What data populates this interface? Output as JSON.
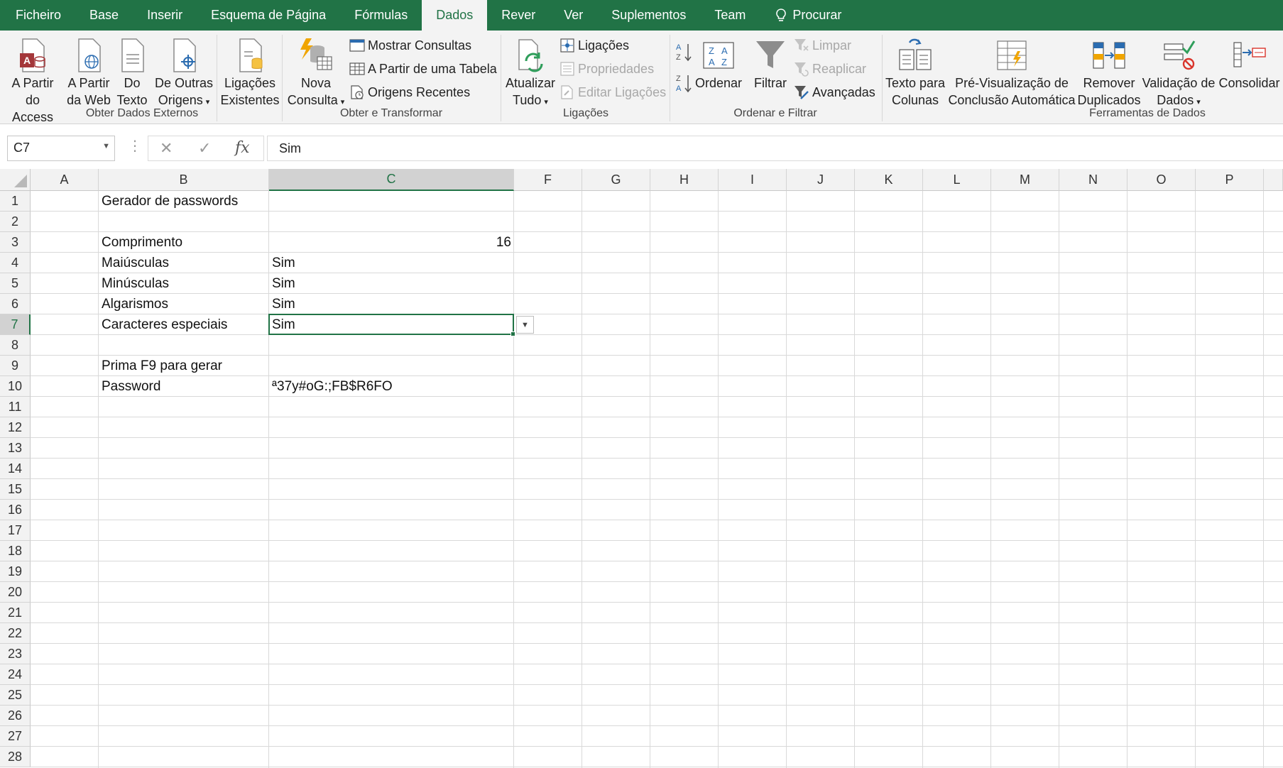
{
  "tabs": [
    "Ficheiro",
    "Base",
    "Inserir",
    "Esquema de Página",
    "Fórmulas",
    "Dados",
    "Rever",
    "Ver",
    "Suplementos",
    "Team",
    "Procurar"
  ],
  "active_tab": "Dados",
  "ribbon": {
    "get_external": {
      "group_label": "Obter Dados Externos",
      "access": {
        "line1": "A Partir",
        "line2": "do Access"
      },
      "web": {
        "line1": "A Partir",
        "line2": "da Web"
      },
      "text": {
        "line1": "Do",
        "line2": "Texto"
      },
      "other": {
        "line1": "De Outras",
        "line2": "Origens"
      },
      "existing": {
        "line1": "Ligações",
        "line2": "Existentes"
      }
    },
    "transform": {
      "group_label": "Obter e Transformar",
      "new_query": {
        "line1": "Nova",
        "line2": "Consulta"
      },
      "show_queries": "Mostrar Consultas",
      "from_table": "A Partir de uma Tabela",
      "recent_sources": "Origens Recentes"
    },
    "connections": {
      "group_label": "Ligações",
      "refresh_all": {
        "line1": "Atualizar",
        "line2": "Tudo"
      },
      "connections": "Ligações",
      "properties": "Propriedades",
      "edit_links": "Editar Ligações"
    },
    "sort_filter": {
      "group_label": "Ordenar e Filtrar",
      "sort_az": "A→Z",
      "sort_za": "Z→A",
      "sort": "Ordenar",
      "filter": "Filtrar",
      "clear": "Limpar",
      "reapply": "Reaplicar",
      "advanced": "Avançadas"
    },
    "data_tools": {
      "group_label": "Ferramentas de Dados",
      "text_to_columns": {
        "line1": "Texto para",
        "line2": "Colunas"
      },
      "flash_fill": {
        "line1": "Pré-Visualização de",
        "line2": "Conclusão Automática"
      },
      "remove_duplicates": {
        "line1": "Remover",
        "line2": "Duplicados"
      },
      "validation": {
        "line1": "Validação de",
        "line2": "Dados"
      },
      "consolidate": {
        "line1": "Consolidar",
        "line2": ""
      }
    }
  },
  "formula_bar": {
    "name_box": "C7",
    "value": "Sim",
    "cancel": "✕",
    "enter": "✓",
    "fx": "fx"
  },
  "columns": [
    "A",
    "B",
    "C",
    "F",
    "G",
    "H",
    "I",
    "J",
    "K",
    "L",
    "M",
    "N",
    "O",
    "P"
  ],
  "selected_column": "C",
  "rows": [
    "1",
    "2",
    "3",
    "4",
    "5",
    "6",
    "7",
    "8",
    "9",
    "10",
    "11",
    "12",
    "13",
    "14",
    "15",
    "16",
    "17",
    "18",
    "19",
    "20",
    "21",
    "22",
    "23",
    "24",
    "25",
    "26",
    "27",
    "28"
  ],
  "selected_row": "7",
  "cells": {
    "B1": "Gerador de passwords",
    "B3": "Comprimento",
    "C3": "16",
    "B4": "Maiúsculas",
    "C4": "Sim",
    "B5": "Minúsculas",
    "C5": "Sim",
    "B6": "Algarismos",
    "C6": "Sim",
    "B7": "Caracteres especiais",
    "C7": "Sim",
    "B9": "Prima F9 para gerar",
    "B10": "Password",
    "C10": "ª37y#oG:;FB$R6FO"
  },
  "colors": {
    "excel_green": "#217346",
    "ribbon_bg": "#f3f3f3",
    "header_bg": "#f2f2f2"
  }
}
